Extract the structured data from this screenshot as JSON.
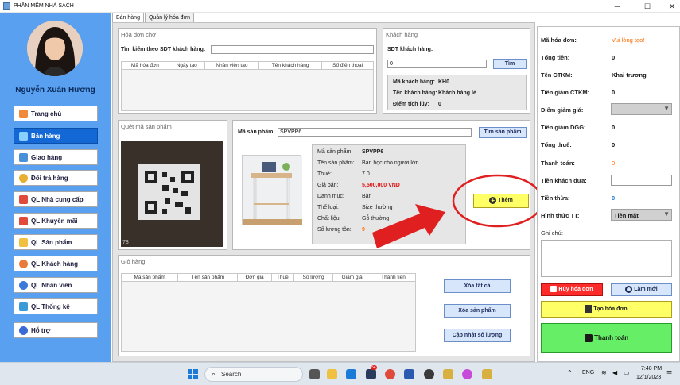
{
  "window": {
    "title": "PHẦN MỀM NHÀ SÁCH"
  },
  "sidebar": {
    "username": "Nguyễn Xuân Hương",
    "items": [
      {
        "label": "Trang chủ"
      },
      {
        "label": "Bán hàng"
      },
      {
        "label": "Giao hàng"
      },
      {
        "label": "Đổi trả hàng"
      },
      {
        "label": "QL Nhà cung cấp"
      },
      {
        "label": "QL Khuyến mãi"
      },
      {
        "label": "QL Sản phẩm"
      },
      {
        "label": "QL Khách hàng"
      },
      {
        "label": "QL Nhân viên"
      },
      {
        "label": "QL Thống kê"
      },
      {
        "label": "Hỗ trợ"
      }
    ]
  },
  "tabs": [
    {
      "label": "Bán hàng"
    },
    {
      "label": "Quản lý hóa đơn"
    }
  ],
  "pending": {
    "title": "Hóa đơn chờ",
    "search_label": "Tìm kiếm theo SDT khách hàng:",
    "search_value": "",
    "columns": [
      "Mã hóa đơn",
      "Ngày tạo",
      "Nhân viên tạo",
      "Tên khách hàng",
      "Số điện thoại"
    ]
  },
  "customer": {
    "title": "Khách hàng",
    "phone_label": "SDT khách hàng:",
    "phone_value": "0",
    "find_button": "Tìm",
    "id_label": "Mã khách hàng:",
    "id_value": "KH0",
    "name_label": "Tên khách hàng:",
    "name_value": "Khách hàng lẻ",
    "points_label": "Điểm tích lũy:",
    "points_value": "0"
  },
  "scan": {
    "title": "Quét mã sản phẩm",
    "camera_overlay": "78"
  },
  "product": {
    "code_label": "Mã sản phẩm:",
    "code_value": "SPVPP6",
    "search_button": "Tìm sản phẩm",
    "fields": [
      {
        "label": "Mã sản phẩm:",
        "value": "SPVPP6"
      },
      {
        "label": "Tên sản phẩm:",
        "value": "Bàn học cho người lớn"
      },
      {
        "label": "Thuế:",
        "value": "7.0"
      },
      {
        "label": "Giá bán:",
        "value": "5,500,000 VND"
      },
      {
        "label": "Danh mục:",
        "value": "Bàn"
      },
      {
        "label": "Thể loại:",
        "value": "Size thường"
      },
      {
        "label": "Chất liệu:",
        "value": "Gỗ thường"
      },
      {
        "label": "Số lượng tồn:",
        "value": "9"
      }
    ],
    "add_button": "Thêm"
  },
  "cart": {
    "title": "Giỏ hàng",
    "columns": [
      "Mã sản phẩm",
      "Tên sản phẩm",
      "Đơn giá",
      "Thuế",
      "Số lượng",
      "Giảm giá",
      "Thành tiền"
    ],
    "clear_button": "Xóa tất cả",
    "remove_button": "Xóa sản phẩm",
    "update_button": "Cập nhật số lượng"
  },
  "invoice": {
    "rows": [
      {
        "label": "Mã hóa đơn:",
        "value": "Vui lòng tạo!"
      },
      {
        "label": "Tổng tiền:",
        "value": "0"
      },
      {
        "label": "Tên CTKM:",
        "value": "Khai trương"
      },
      {
        "label": "Tiền giảm CTKM:",
        "value": "0"
      },
      {
        "label": "Điểm giảm giá:",
        "value": ""
      },
      {
        "label": "Tiền giảm DGG:",
        "value": "0"
      },
      {
        "label": "Tổng thuế:",
        "value": "0"
      },
      {
        "label": "Thanh toán:",
        "value": "0"
      },
      {
        "label": "Tiền khách đưa:",
        "value": ""
      },
      {
        "label": "Tiền thừa:",
        "value": "0"
      },
      {
        "label": "Hình thức TT:",
        "value": "Tiền mặt"
      }
    ],
    "note_label": "Ghi chú:",
    "cancel_button": "Hủy hóa đơn",
    "refresh_button": "Làm mới",
    "create_button": "Tạo hóa đơn",
    "pay_button": "Thanh toán"
  },
  "taskbar": {
    "search_placeholder": "Search",
    "lang": "ENG",
    "time": "7:48 PM",
    "date": "12/1/2023",
    "badge": "54"
  },
  "colors": {
    "sidebar": "#5aa0f0",
    "active_nav": "#1468d6",
    "warning": "#ff6a00",
    "info": "#1a7ad8",
    "annotation_red": "#e02020",
    "add_button": "#ffff66",
    "pay_button": "#66ee66",
    "cancel_button": "#ff2a2a"
  }
}
